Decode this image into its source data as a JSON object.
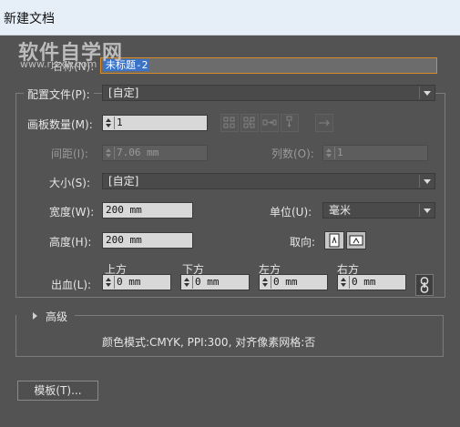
{
  "window": {
    "title": "新建文档"
  },
  "watermark": {
    "brand": "软件自学网",
    "url": "www.rjzxw.com"
  },
  "name": {
    "label": "名称(N):",
    "value": "未标题-2"
  },
  "profile": {
    "label": "配置文件(P):",
    "value": "[自定]"
  },
  "artboards": {
    "count_label": "画板数量(M):",
    "count_value": "1",
    "spacing_label": "间距(I):",
    "spacing_value": "7.06 mm",
    "columns_label": "列数(O):",
    "columns_value": "1",
    "arrange_icons": [
      "grid-by-row-icon",
      "grid-by-column-icon",
      "arrange-by-row-icon",
      "arrange-by-column-icon",
      "right-to-left-icon"
    ]
  },
  "size": {
    "label": "大小(S):",
    "value": "[自定]"
  },
  "width": {
    "label": "宽度(W):",
    "value": "200 mm"
  },
  "units": {
    "label": "单位(U):",
    "value": "毫米"
  },
  "height": {
    "label": "高度(H):",
    "value": "200 mm"
  },
  "orientation": {
    "label": "取向:",
    "options": [
      "portrait-icon",
      "landscape-icon"
    ],
    "selected": "portrait"
  },
  "bleed": {
    "label": "出血(L):",
    "top_label": "上方",
    "top_value": "0 mm",
    "bottom_label": "下方",
    "bottom_value": "0 mm",
    "left_label": "左方",
    "left_value": "0 mm",
    "right_label": "右方",
    "right_value": "0 mm",
    "link_icon": "link-icon"
  },
  "advanced": {
    "label": "高级",
    "summary": "颜色模式:CMYK, PPI:300, 对齐像素网格:否"
  },
  "templates_button": {
    "label": "模板(T)..."
  }
}
